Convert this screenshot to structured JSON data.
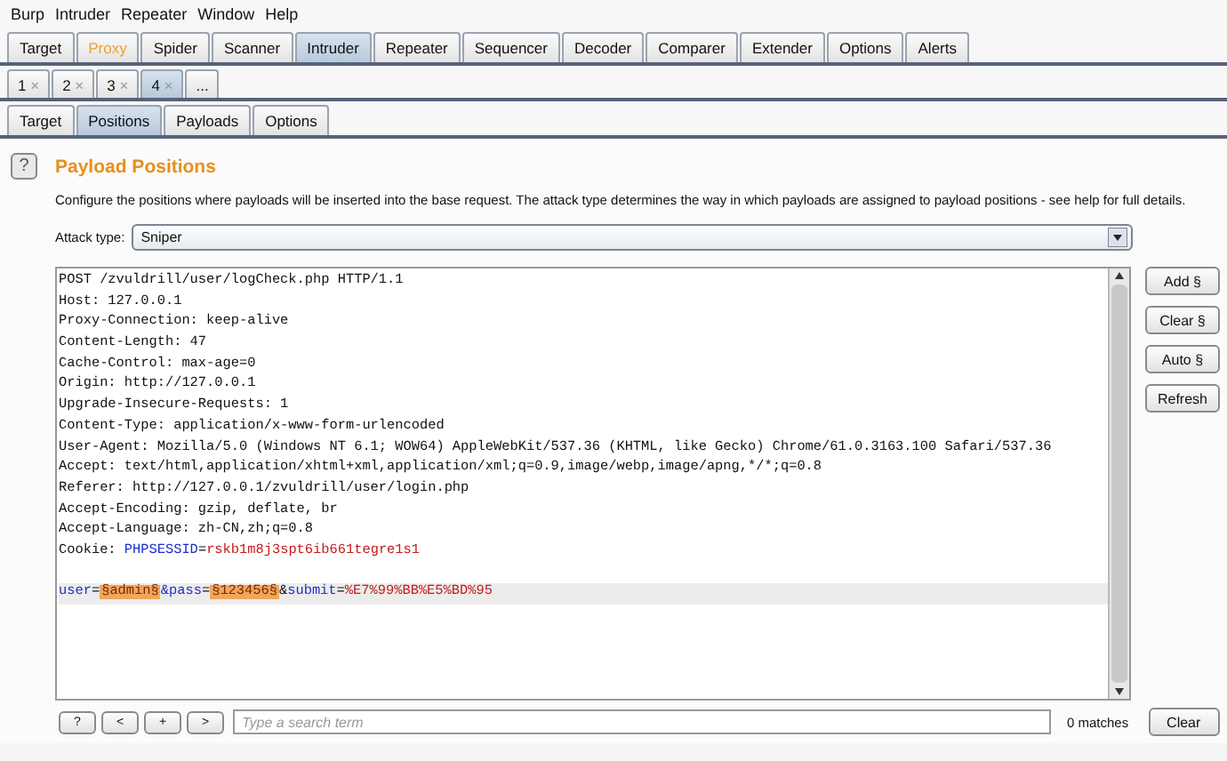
{
  "menu": [
    "Burp",
    "Intruder",
    "Repeater",
    "Window",
    "Help"
  ],
  "main_tabs": [
    {
      "label": "Target",
      "selected": false,
      "highlighted": false
    },
    {
      "label": "Proxy",
      "selected": false,
      "highlighted": true
    },
    {
      "label": "Spider",
      "selected": false,
      "highlighted": false
    },
    {
      "label": "Scanner",
      "selected": false,
      "highlighted": false
    },
    {
      "label": "Intruder",
      "selected": true,
      "highlighted": false
    },
    {
      "label": "Repeater",
      "selected": false,
      "highlighted": false
    },
    {
      "label": "Sequencer",
      "selected": false,
      "highlighted": false
    },
    {
      "label": "Decoder",
      "selected": false,
      "highlighted": false
    },
    {
      "label": "Comparer",
      "selected": false,
      "highlighted": false
    },
    {
      "label": "Extender",
      "selected": false,
      "highlighted": false
    },
    {
      "label": "Options",
      "selected": false,
      "highlighted": false
    },
    {
      "label": "Alerts",
      "selected": false,
      "highlighted": false
    }
  ],
  "attack_tabs": [
    {
      "label": "1",
      "close": "×",
      "selected": false
    },
    {
      "label": "2",
      "close": "×",
      "selected": false
    },
    {
      "label": "3",
      "close": "×",
      "selected": false
    },
    {
      "label": "4",
      "close": "×",
      "selected": true
    },
    {
      "label": "...",
      "selected": false
    }
  ],
  "sub_tabs": [
    {
      "label": "Target",
      "selected": false
    },
    {
      "label": "Positions",
      "selected": true
    },
    {
      "label": "Payloads",
      "selected": false
    },
    {
      "label": "Options",
      "selected": false
    }
  ],
  "panel": {
    "help": "?",
    "title": "Payload Positions",
    "description": "Configure the positions where payloads will be inserted into the base request. The attack type determines the way in which payloads are assigned to payload positions - see help for full details.",
    "attack_type_label": "Attack type:",
    "attack_type": "Sniper"
  },
  "request_lines": [
    {
      "highlighted": false,
      "segments": [
        {
          "kind": "plain",
          "text": "POST /zvuldrill/user/logCheck.php HTTP/1.1"
        }
      ]
    },
    {
      "highlighted": false,
      "segments": [
        {
          "kind": "plain",
          "text": "Host: 127.0.0.1"
        }
      ]
    },
    {
      "highlighted": false,
      "segments": [
        {
          "kind": "plain",
          "text": "Proxy-Connection: keep-alive"
        }
      ]
    },
    {
      "highlighted": false,
      "segments": [
        {
          "kind": "plain",
          "text": "Content-Length: 47"
        }
      ]
    },
    {
      "highlighted": false,
      "segments": [
        {
          "kind": "plain",
          "text": "Cache-Control: max-age=0"
        }
      ]
    },
    {
      "highlighted": false,
      "segments": [
        {
          "kind": "plain",
          "text": "Origin: http://127.0.0.1"
        }
      ]
    },
    {
      "highlighted": false,
      "segments": [
        {
          "kind": "plain",
          "text": "Upgrade-Insecure-Requests: 1"
        }
      ]
    },
    {
      "highlighted": false,
      "segments": [
        {
          "kind": "plain",
          "text": "Content-Type: application/x-www-form-urlencoded"
        }
      ]
    },
    {
      "highlighted": false,
      "segments": [
        {
          "kind": "plain",
          "text": "User-Agent: Mozilla/5.0 (Windows NT 6.1; WOW64) AppleWebKit/537.36 (KHTML, like Gecko) Chrome/61.0.3163.100 Safari/537.36"
        }
      ]
    },
    {
      "highlighted": false,
      "segments": [
        {
          "kind": "plain",
          "text": "Accept: text/html,application/xhtml+xml,application/xml;q=0.9,image/webp,image/apng,*/*;q=0.8"
        }
      ]
    },
    {
      "highlighted": false,
      "segments": [
        {
          "kind": "plain",
          "text": "Referer: http://127.0.0.1/zvuldrill/user/login.php"
        }
      ]
    },
    {
      "highlighted": false,
      "segments": [
        {
          "kind": "plain",
          "text": "Accept-Encoding: gzip, deflate, br"
        }
      ]
    },
    {
      "highlighted": false,
      "segments": [
        {
          "kind": "plain",
          "text": "Accept-Language: zh-CN,zh;q=0.8"
        }
      ]
    },
    {
      "highlighted": false,
      "segments": [
        {
          "kind": "plain",
          "text": "Cookie: "
        },
        {
          "kind": "name",
          "text": "PHPSESSID"
        },
        {
          "kind": "plain",
          "text": "="
        },
        {
          "kind": "value",
          "text": "rskb1m8j3spt6ib661tegre1s1"
        }
      ]
    },
    {
      "highlighted": false
    },
    {
      "highlighted": true,
      "segments": [
        {
          "kind": "name",
          "text": "user"
        },
        {
          "kind": "plain",
          "text": "="
        },
        {
          "kind": "payload",
          "text": "§admin§"
        },
        {
          "kind": "name",
          "text": "&pass"
        },
        {
          "kind": "plain",
          "text": "="
        },
        {
          "kind": "payload",
          "text": "§123456§"
        },
        {
          "kind": "plain",
          "text": "&"
        },
        {
          "kind": "name",
          "text": "submit"
        },
        {
          "kind": "plain",
          "text": "="
        },
        {
          "kind": "value",
          "text": "%E7%99%BB%E5%BD%95"
        }
      ]
    }
  ],
  "side_buttons": [
    "Add §",
    "Clear §",
    "Auto §",
    "Refresh"
  ],
  "search": {
    "buttons": [
      "?",
      "<",
      "+",
      ">"
    ],
    "placeholder": "Type a search term",
    "matches": "0 matches",
    "clear": "Clear"
  }
}
